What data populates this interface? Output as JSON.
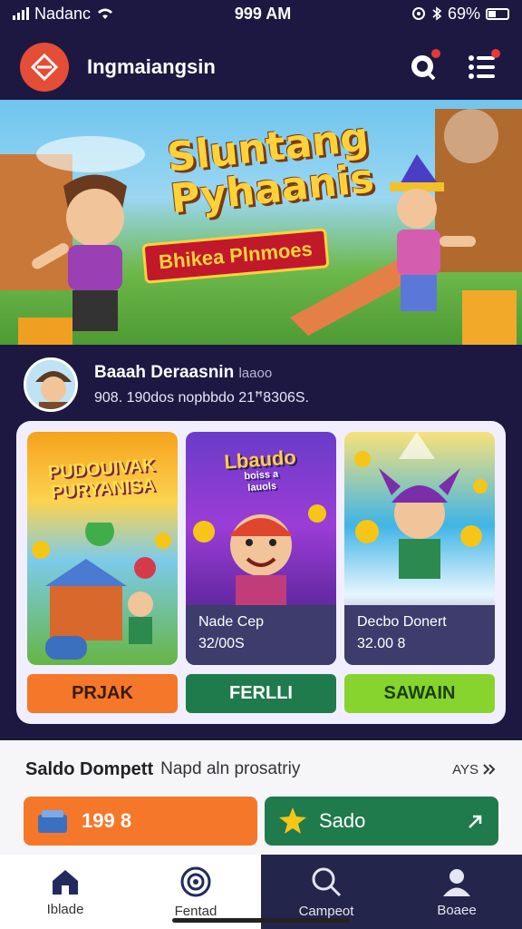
{
  "status": {
    "carrier": "Nadanc",
    "time": "999 AM",
    "battery": "69%"
  },
  "header": {
    "title": "Ingmaiangsin",
    "icons": [
      "logo-icon",
      "chat-icon",
      "menu-icon"
    ]
  },
  "banner": {
    "title_line1": "Sluntang",
    "title_line2": "Pyhaanis",
    "subtitle": "Bhikea Plnmoes"
  },
  "profile": {
    "name": "Baaah Deraasnin",
    "tag": "laaoo",
    "line": "908. 190dos nopbbdo 21ꟸ8306S."
  },
  "games": [
    {
      "title": "PUDOUIVAK PURYANISA",
      "info_name": "",
      "info_value": "",
      "button": "PRJAK",
      "style": "orange"
    },
    {
      "title": "Lbaudo",
      "title_small": "boiss a",
      "title_sub": "Iauols",
      "info_name": "Nade Cep",
      "info_value": "32/00S",
      "button": "FERLLI",
      "style": "green"
    },
    {
      "title": "",
      "info_name": "Decbo Donert",
      "info_value": "32.00 8",
      "button": "SAWAIN",
      "style": "lime"
    }
  ],
  "wallet": {
    "title": "Saldo Dompett",
    "note": "Napd aln prosatriy",
    "more": "AYS",
    "balance": "199 8",
    "action_label": "Sado"
  },
  "nav": [
    {
      "label": "Iblade",
      "icon": "home-icon"
    },
    {
      "label": "Fentad",
      "icon": "globe-icon"
    },
    {
      "label": "Campeot",
      "icon": "search-icon"
    },
    {
      "label": "Boaee",
      "icon": "profile-icon"
    }
  ],
  "colors": {
    "background": "#1c1842",
    "orange": "#f4772a",
    "green": "#1f7a4c",
    "lime": "#86d42d"
  }
}
